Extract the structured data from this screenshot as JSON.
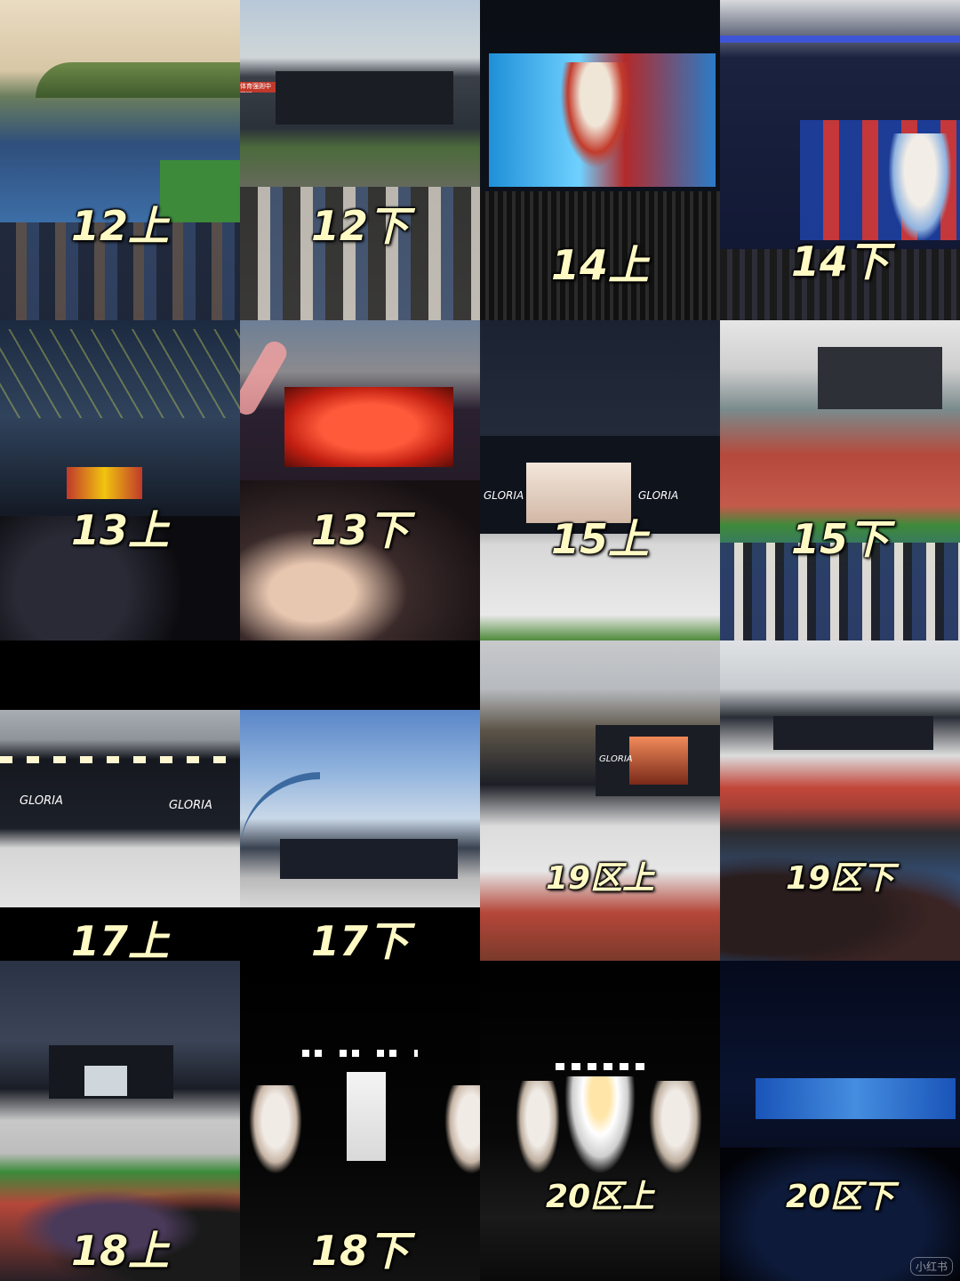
{
  "tiles": [
    {
      "label": "12上"
    },
    {
      "label": "12下"
    },
    {
      "label": "14上"
    },
    {
      "label": "14下"
    },
    {
      "label": "13上"
    },
    {
      "label": "13下"
    },
    {
      "label": "15上"
    },
    {
      "label": "15下"
    },
    {
      "label": "17上"
    },
    {
      "label": "17下"
    },
    {
      "label": "19区上"
    },
    {
      "label": "19区下"
    },
    {
      "label": "18上"
    },
    {
      "label": "18下"
    },
    {
      "label": "20区上"
    },
    {
      "label": "20区下"
    }
  ],
  "screen_text": {
    "gloria": "GLORIA",
    "brand_banner": "体育强则中国强"
  },
  "watermark": "小红书",
  "colors": {
    "label_text": "#fff9c4",
    "sunset_sky": "#e9d7b8",
    "blue_seats": "#3a6fb0",
    "track_red": "#b54a3c",
    "stage_red": "#e8351f",
    "night": "#0a0f1e"
  }
}
